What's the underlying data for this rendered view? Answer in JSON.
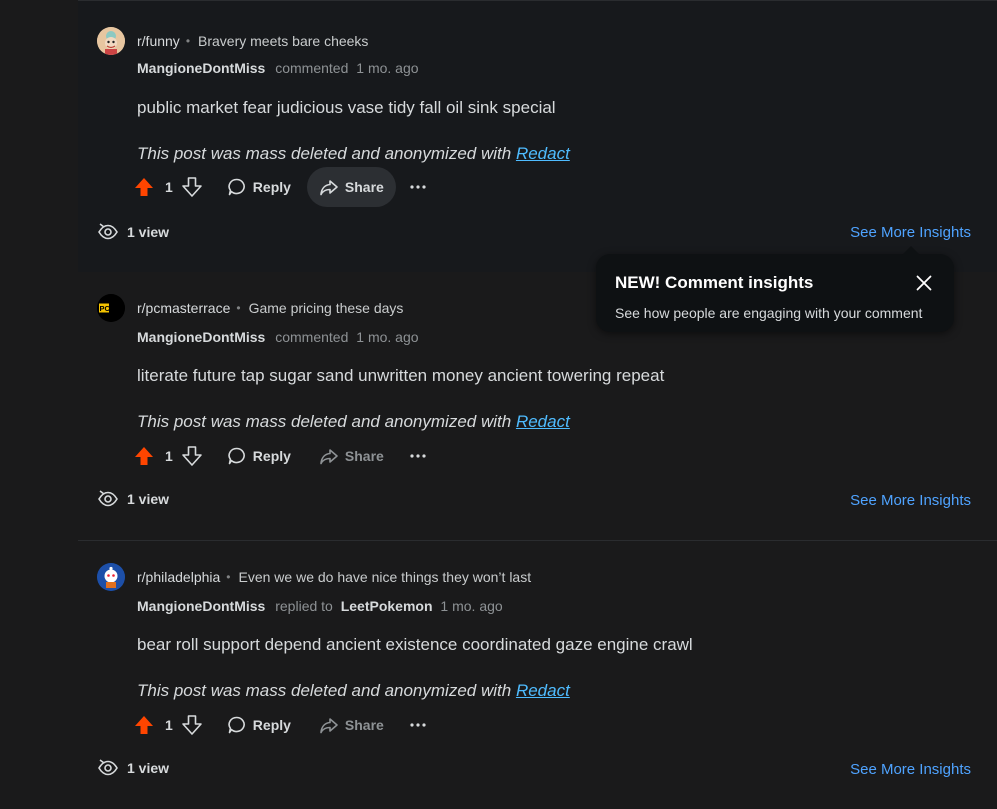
{
  "comments": [
    {
      "subreddit": "r/funny",
      "avatar_icon": "funny-subreddit-avatar",
      "post_title": "Bravery meets bare cheeks",
      "author": "MangioneDontMiss",
      "action": "commented",
      "reply_to": "",
      "time": "1 mo. ago",
      "body": "public market fear judicious vase tidy fall oil sink special",
      "footer_prefix": "This post was mass deleted and anonymized with",
      "footer_link": "Redact",
      "score": "1",
      "reply_label": "Reply",
      "share_label": "Share",
      "views": "1 view",
      "insights_label": "See More Insights"
    },
    {
      "subreddit": "r/pcmasterrace",
      "avatar_icon": "pcmr-subreddit-avatar",
      "avatar_text": "PCMR",
      "post_title": "Game pricing these days",
      "author": "MangioneDontMiss",
      "action": "commented",
      "reply_to": "",
      "time": "1 mo. ago",
      "body": "literate future tap sugar sand unwritten money ancient towering repeat",
      "footer_prefix": "This post was mass deleted and anonymized with",
      "footer_link": "Redact",
      "score": "1",
      "reply_label": "Reply",
      "share_label": "Share",
      "views": "1 view",
      "insights_label": "See More Insights"
    },
    {
      "subreddit": "r/philadelphia",
      "avatar_icon": "philadelphia-subreddit-avatar",
      "post_title": "Even we we do have nice things they won’t last",
      "author": "MangioneDontMiss",
      "action": "replied to",
      "reply_to": "LeetPokemon",
      "time": "1 mo. ago",
      "body": "bear roll support depend ancient existence coordinated gaze engine crawl",
      "footer_prefix": "This post was mass deleted and anonymized with",
      "footer_link": "Redact",
      "score": "1",
      "reply_label": "Reply",
      "share_label": "Share",
      "views": "1 view",
      "insights_label": "See More Insights"
    }
  ],
  "tooltip": {
    "title": "NEW! Comment insights",
    "body": "See how people are engaging with your comment"
  },
  "colors": {
    "upvote": "#ff4500",
    "link": "#4fa3ff",
    "background": "#1a1a1b"
  }
}
